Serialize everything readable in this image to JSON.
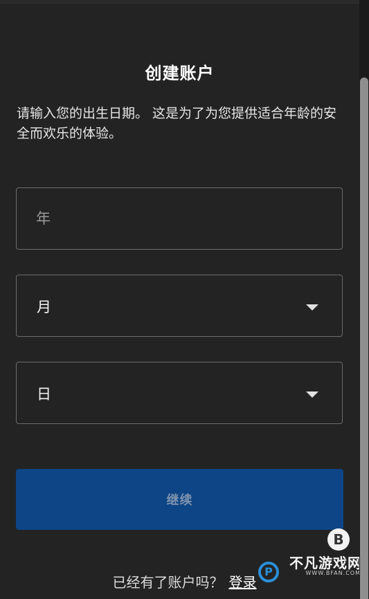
{
  "header": {
    "title": "创建账户"
  },
  "description": "请输入您的出生日期。 这是为了为您提供适合年龄的安全而欢乐的体验。",
  "form": {
    "year": {
      "placeholder": "年",
      "value": ""
    },
    "month": {
      "selected": "月"
    },
    "day": {
      "selected": "日"
    },
    "continue_label": "继续"
  },
  "footer": {
    "prompt": "已经有了账户吗？",
    "login_label": "登录"
  },
  "watermark": {
    "site_name": "不凡游戏网",
    "url": "WWW.BFAN.COM"
  },
  "colors": {
    "background": "#232323",
    "primary_button": "#0d4586",
    "field_border": "#6d6d6d"
  },
  "icons": {
    "dropdown": "chevron-down-icon"
  }
}
